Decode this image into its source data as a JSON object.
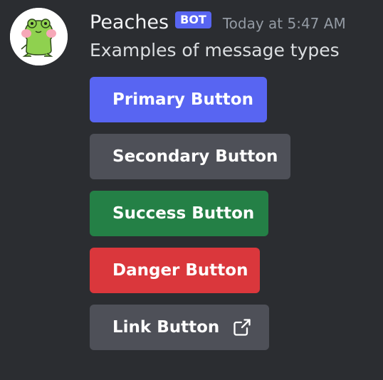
{
  "message": {
    "username": "Peaches",
    "badge": "BOT",
    "timestamp": "Today at 5:47 AM",
    "content": "Examples of message types",
    "avatar_icon": "frog-avatar-icon"
  },
  "buttons": [
    {
      "label": "Primary Button",
      "style": "primary",
      "color": "#5865f2"
    },
    {
      "label": "Secondary Button",
      "style": "secondary",
      "color": "#4e5058"
    },
    {
      "label": "Success Button",
      "style": "success",
      "color": "#248046"
    },
    {
      "label": "Danger Button",
      "style": "danger",
      "color": "#da373c"
    },
    {
      "label": "Link Button",
      "style": "link",
      "color": "#4e5058",
      "icon": "external-link-icon"
    }
  ],
  "colors": {
    "background": "#2b2d31",
    "username": "#f2f3f5",
    "timestamp": "#949ba4",
    "text": "#dbdee1",
    "badge": "#5865f2"
  }
}
